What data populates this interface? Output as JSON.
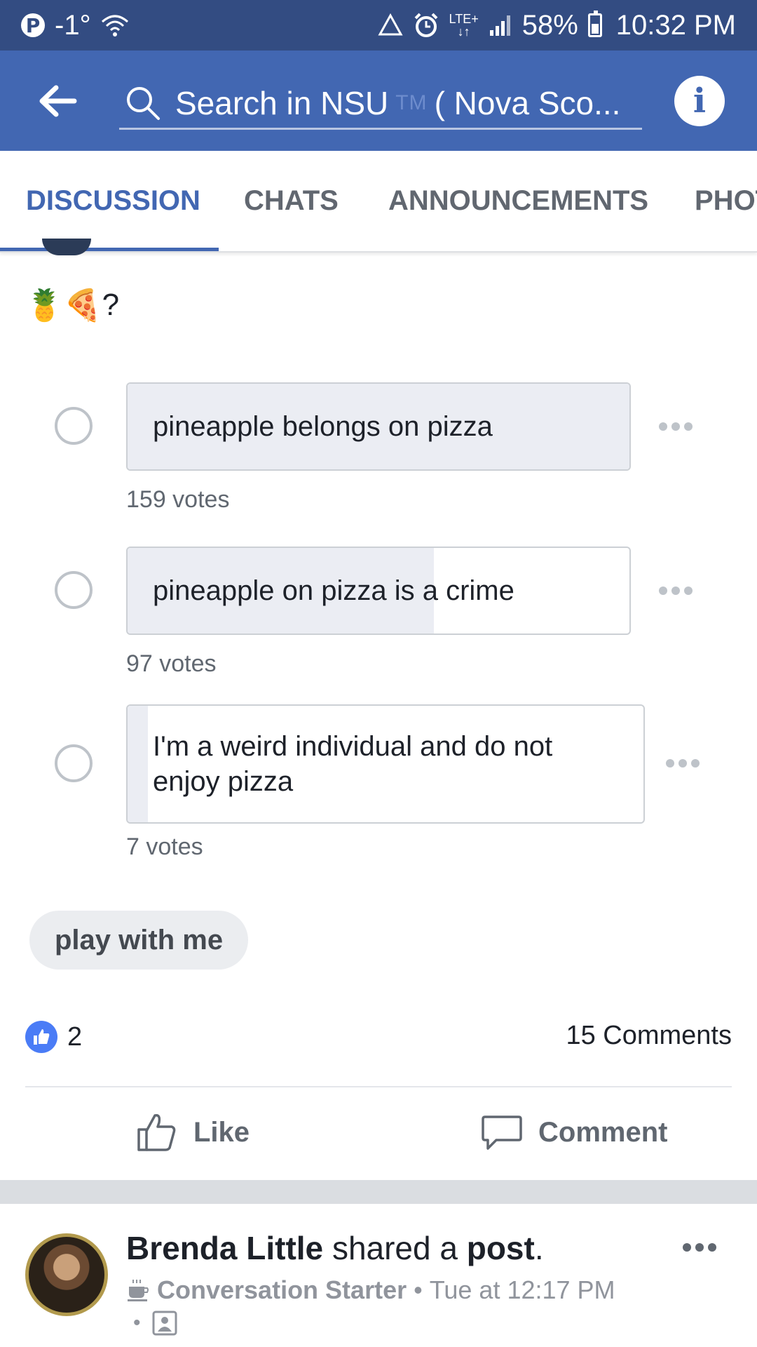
{
  "status_bar": {
    "temperature": "-1°",
    "battery": "58%",
    "battery_level": 0.58,
    "time": "10:32 PM",
    "network": "LTE+"
  },
  "header": {
    "search_label": "Search in NSU",
    "search_tm": "TM",
    "search_group": "( Nova Sco...",
    "info_label": "i"
  },
  "tabs": [
    {
      "label": "DISCUSSION",
      "active": true
    },
    {
      "label": "CHATS",
      "active": false
    },
    {
      "label": "ANNOUNCEMENTS",
      "active": false
    },
    {
      "label": "PHOT",
      "active": false
    }
  ],
  "post": {
    "emoji_text": "🍍🍕",
    "question_mark": "?",
    "poll": [
      {
        "text": "pineapple belongs on pizza",
        "votes": "159 votes",
        "fill_fraction": 1.0
      },
      {
        "text": "pineapple on pizza is a crime",
        "votes": "97 votes",
        "fill_fraction": 0.61
      },
      {
        "text": "I'm a weird individual and do not enjoy pizza",
        "votes": "7 votes",
        "fill_fraction": 0.04
      }
    ],
    "chip_label": "play with me",
    "reaction_count": "2",
    "comments_label": "15 Comments",
    "like_label": "Like",
    "comment_label": "Comment"
  },
  "next_post": {
    "author": "Brenda Little",
    "verb": "shared a",
    "object": "post",
    "period": ".",
    "group": "Conversation Starter",
    "separator": "•",
    "timestamp": "Tue at 12:17 PM",
    "line2_dot": "•"
  },
  "colors": {
    "status_bar": "#334c82",
    "header": "#4267b2",
    "accent": "#4267b2",
    "poll_fill": "#ebedf3"
  }
}
